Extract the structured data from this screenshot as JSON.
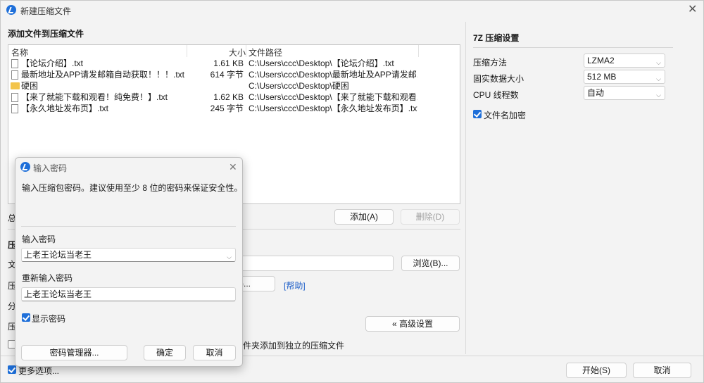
{
  "window": {
    "title": "新建压缩文件",
    "close_glyph": "✕"
  },
  "files_section": {
    "title": "添加文件到压缩文件",
    "columns": [
      "名称",
      "大小",
      "文件路径"
    ],
    "rows": [
      {
        "name": "【论坛介绍】.txt",
        "size": "1.61 KB",
        "path": "C:\\Users\\ccc\\Desktop\\【论坛介绍】.txt",
        "icon": "file-icon"
      },
      {
        "name": "最新地址及APP请发邮箱自动获取！！！.txt",
        "size": "614 字节",
        "path": "C:\\Users\\ccc\\Desktop\\最新地址及APP请发邮...",
        "icon": "file-icon"
      },
      {
        "name": "硬困",
        "size": "",
        "path": "C:\\Users\\ccc\\Desktop\\硬困",
        "icon": "folder-icon"
      },
      {
        "name": "【来了就能下载和观看！纯免费！】.txt",
        "size": "1.62 KB",
        "path": "C:\\Users\\ccc\\Desktop\\【来了就能下载和观看...",
        "icon": "file-icon"
      },
      {
        "name": "【永久地址发布页】.txt",
        "size": "245 字节",
        "path": "C:\\Users\\ccc\\Desktop\\【永久地址发布页】.txt",
        "icon": "file-icon"
      }
    ],
    "add_button": "添加(A)",
    "delete_button": "删除(D)",
    "total_label_fragment": "总"
  },
  "archive_section": {
    "heading_fragment": "压",
    "file_label_fragment": "文",
    "format_label_fragment": "压",
    "split_label_fragment": "分",
    "compress_label_fragment": "压",
    "browse_button": "浏览(B)...",
    "format_button_fragment": ")...",
    "help_link": "[帮助]",
    "advanced_button": "« 高级设置",
    "separate_archive_fragment": "件夹添加到独立的压缩文件"
  },
  "settings_7z": {
    "title": "7Z 压缩设置",
    "method_label": "压缩方法",
    "method_value": "LZMA2",
    "dict_label": "固实数据大小",
    "dict_value": "512 MB",
    "threads_label": "CPU 线程数",
    "threads_value": "自动",
    "encrypt_names_label": "文件名加密",
    "encrypt_names_checked": true
  },
  "footer": {
    "more_options_label": "更多选项...",
    "start_button": "开始(S)",
    "cancel_button": "取消"
  },
  "password_dialog": {
    "title": "输入密码",
    "description": "输入压缩包密码。建议使用至少 8 位的密码来保证安全性。",
    "password_label": "输入密码",
    "password_value": "上老王论坛当老王",
    "reenter_label": "重新输入密码",
    "reenter_value": "上老王论坛当老王",
    "show_password_label": "显示密码",
    "show_password_checked": true,
    "manager_button": "密码管理器...",
    "ok_button": "确定",
    "cancel_button": "取消"
  },
  "colors": {
    "accent": "#1e6fd9",
    "link": "#1e5fc9",
    "window_bg": "#f3f3f3"
  }
}
